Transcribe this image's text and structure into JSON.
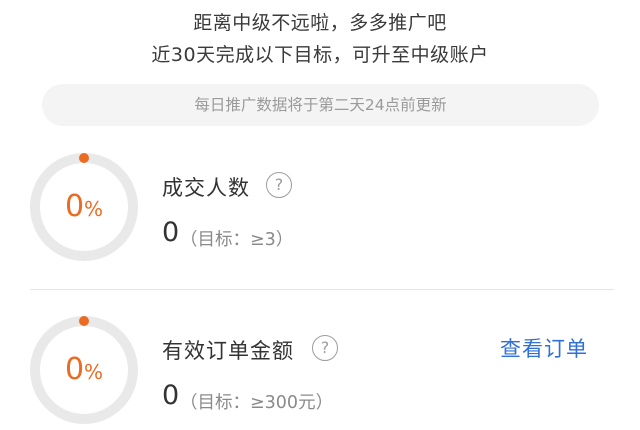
{
  "header": {
    "line1": "距离中级不远啦，多多推广吧",
    "line2": "近30天完成以下目标，可升至中级账户"
  },
  "notice": "每日推广数据将于第二天24点前更新",
  "metrics": [
    {
      "percent_number": "0",
      "percent_sign": "%",
      "progress": 0,
      "label": "成交人数",
      "help_icon": "question-circle-icon",
      "help_glyph": "?",
      "value": "0",
      "target": "（目标：≥3）"
    },
    {
      "percent_number": "0",
      "percent_sign": "%",
      "progress": 0,
      "label": "有效订单金额",
      "help_icon": "question-circle-icon",
      "help_glyph": "?",
      "value": "0",
      "target": "（目标：≥300元）",
      "link_label": "查看订单"
    }
  ],
  "colors": {
    "accent": "#ec6b23",
    "link": "#2f6fd6",
    "ring_track": "#e9e9e9",
    "notice_bg": "#f4f4f4"
  }
}
